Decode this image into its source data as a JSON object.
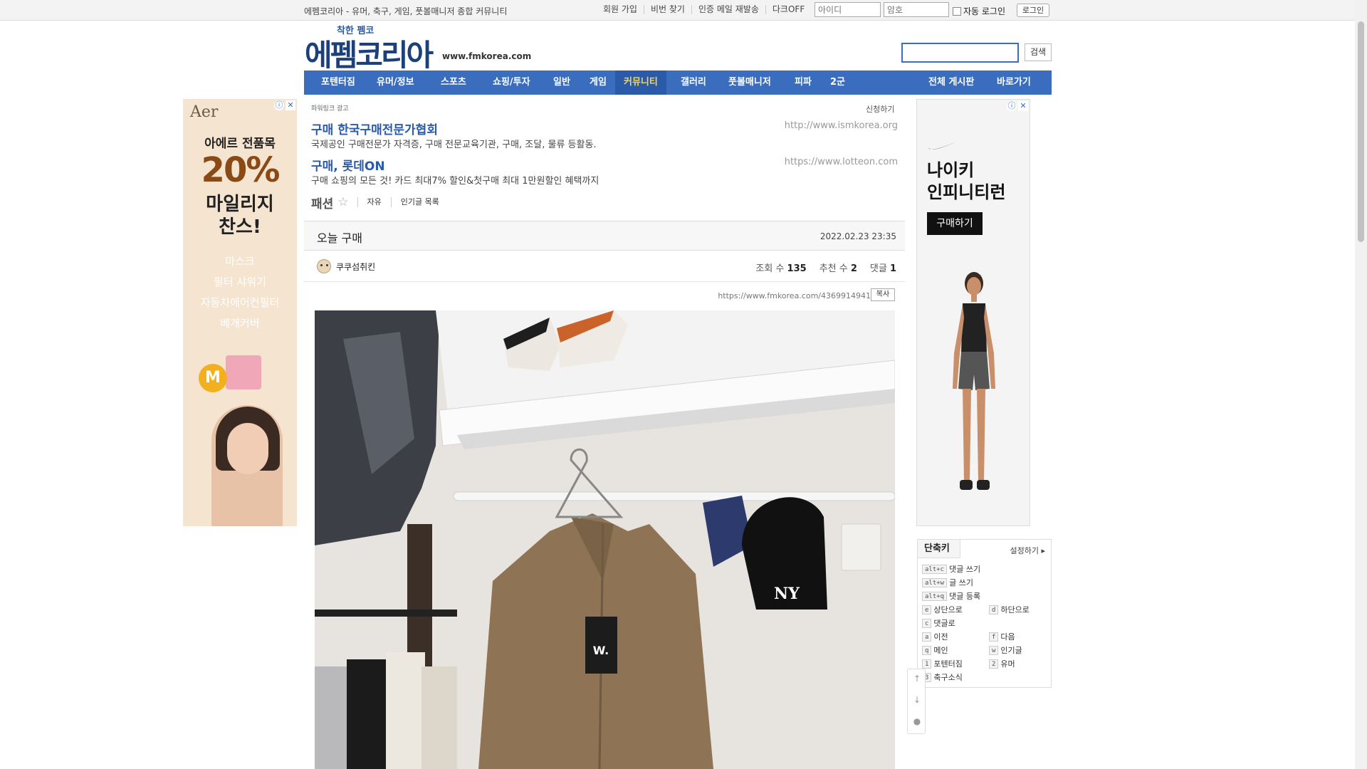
{
  "topbar": {
    "site_desc": "에펨코리아 - 유머, 축구, 게임, 풋볼매니저 종합 커뮤니티",
    "links": [
      "회원 가입",
      "비번 찾기",
      "인증 메일 재발송",
      "다크OFF"
    ],
    "id_placeholder": "아이디",
    "pw_placeholder": "암호",
    "auto_login": "자동 로그인",
    "login_button": "로그인"
  },
  "header": {
    "logo_small": "착한 펨코",
    "logo_big": "에펨코리아",
    "url": "www.fmkorea.com",
    "search_button": "검색"
  },
  "nav": {
    "items": [
      "포텐터짐",
      "유머/정보",
      "스포츠",
      "쇼핑/투자",
      "일반",
      "게임",
      "커뮤니티",
      "갤러리",
      "풋볼매니저",
      "피파",
      "2군"
    ],
    "active": "커뮤니티",
    "right_items": [
      "전체 게시판",
      "바로가기"
    ]
  },
  "left_ad": {
    "brand": "Aer",
    "line1": "아에르 전품목",
    "line2": "20%",
    "line3a": "마일리지",
    "line3b": "찬스!",
    "items": [
      "마스크",
      "필터 샤워기",
      "자동차에어컨필터",
      "베개커버"
    ],
    "coin": "M"
  },
  "right_ad": {
    "title_a": "나이키",
    "title_b": "인피니티런",
    "buy": "구매하기"
  },
  "powerlink": {
    "label": "파워링크 광고",
    "apply": "신청하기",
    "ads": [
      {
        "title": "구매 한국구매전문가협회",
        "desc": "국제공인 구매전문가 자격증, 구매 전문교육기관, 구매, 조달, 물류 등활동.",
        "url": "http://www.ismkorea.org"
      },
      {
        "title": "구매, 롯데ON",
        "desc": "구매 쇼핑의 모든 것! 카드 최대7% 할인&첫구매 최대 1만원할인 혜택까지",
        "url": "https://www.lotteon.com"
      }
    ]
  },
  "board": {
    "name": "패션",
    "star": "☆",
    "tabs": [
      "자유",
      "인기글 목록"
    ]
  },
  "post": {
    "title": "오늘 구매",
    "date": "2022.02.23 23:35",
    "author": "쿠쿠섬취킨",
    "views_label": "조회 수",
    "views": "135",
    "likes_label": "추천 수",
    "likes": "2",
    "comments_label": "댓글",
    "comments": "1",
    "permalink": "https://www.fmkorea.com/4369914941",
    "copy_button": "복사",
    "tag_text": "W."
  },
  "shortcuts": {
    "tab": "단축키",
    "setting": "설정하기",
    "rows": [
      {
        "key": "alt+c",
        "label": "댓글 쓰기"
      },
      {
        "key": "alt+w",
        "label": "글 쓰기"
      },
      {
        "key": "alt+q",
        "label": "댓글 등록"
      },
      {
        "key": "e",
        "label": "상단으로",
        "key2": "d",
        "label2": "하단으로"
      },
      {
        "key": "c",
        "label": "댓글로"
      },
      {
        "key": "a",
        "label": "이전",
        "key2": "f",
        "label2": "다음"
      },
      {
        "key": "q",
        "label": "메인",
        "key2": "w",
        "label2": "인기글"
      },
      {
        "key": "1",
        "label": "포텐터짐",
        "key2": "2",
        "label2": "유머"
      },
      {
        "key": "3",
        "label": "축구소식"
      }
    ]
  },
  "colors": {
    "nav_bg": "#3b6dbf",
    "nav_active_text": "#ffd640",
    "link_blue": "#2a5aa8"
  }
}
